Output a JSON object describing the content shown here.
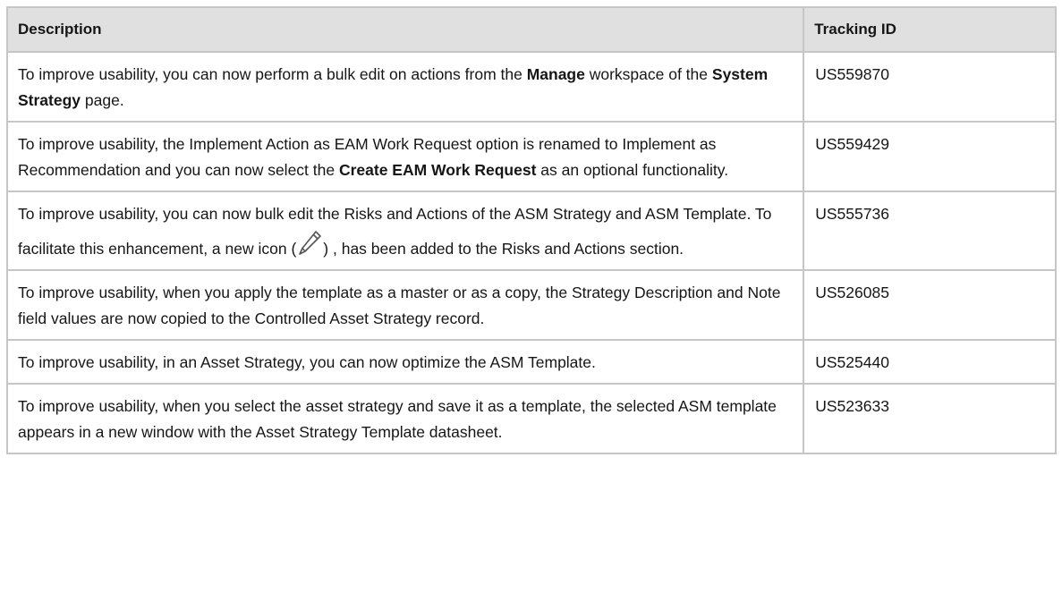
{
  "table": {
    "headers": {
      "description": "Description",
      "tracking_id": "Tracking ID"
    },
    "rows": [
      {
        "parts": [
          {
            "text": "To improve usability, you can now perform a bulk edit on actions from the ",
            "bold": false
          },
          {
            "text": "Manage",
            "bold": true
          },
          {
            "text": " workspace of the ",
            "bold": false
          },
          {
            "text": "System Strategy",
            "bold": true
          },
          {
            "text": " page.",
            "bold": false
          }
        ],
        "tracking_id": "US559870"
      },
      {
        "parts": [
          {
            "text": "To improve usability, the Implement Action as EAM Work Request option is renamed to Implement as Recommendation and you can now select the ",
            "bold": false
          },
          {
            "text": "Create EAM Work Request",
            "bold": true
          },
          {
            "text": " as an optional functionality.",
            "bold": false
          }
        ],
        "tracking_id": "US559429"
      },
      {
        "parts": [
          {
            "text": "To improve usability, you can now bulk edit the Risks and Actions of the ASM Strategy and ASM Template. To facilitate this enhancement, a new icon (",
            "bold": false
          },
          {
            "icon": "pencil-edit-icon"
          },
          {
            "text": ") , has been added to the Risks and Actions section.",
            "bold": false
          }
        ],
        "tracking_id": "US555736"
      },
      {
        "parts": [
          {
            "text": "To improve usability, when you apply the template as a master or as a copy, the Strategy Description and Note field values are now copied to the Controlled Asset Strategy record.",
            "bold": false
          }
        ],
        "tracking_id": "US526085"
      },
      {
        "parts": [
          {
            "text": "To improve usability, in an Asset Strategy, you can now optimize the ASM Template.",
            "bold": false
          }
        ],
        "tracking_id": "US525440"
      },
      {
        "parts": [
          {
            "text": "To improve usability, when you select the asset strategy and save it as a template, the selected ASM template appears in a new window with the Asset Strategy Template datasheet.",
            "bold": false
          }
        ],
        "tracking_id": "US523633"
      }
    ]
  },
  "colors": {
    "header_bg": "#e0e0e0",
    "border": "#c6c6c6",
    "text": "#161616"
  }
}
